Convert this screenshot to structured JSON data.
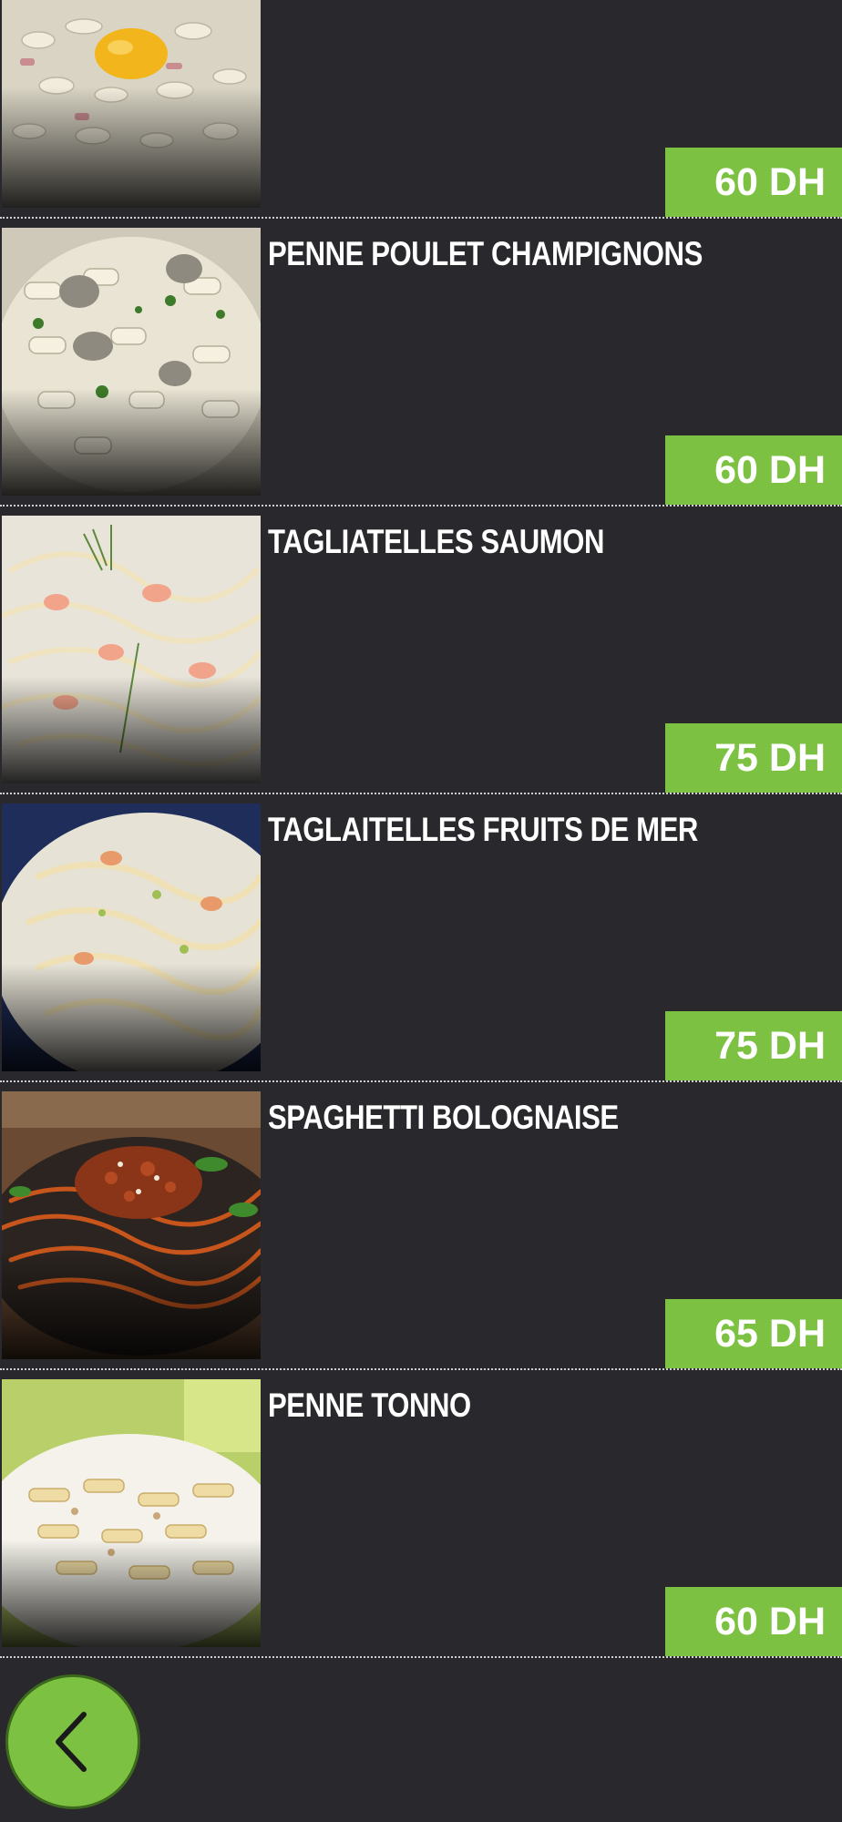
{
  "items": [
    {
      "name": "",
      "price": "60 DH",
      "image_icon": "pasta-carbonara-photo"
    },
    {
      "name": "PENNE POULET CHAMPIGNONS",
      "price": "60 DH",
      "image_icon": "penne-chicken-mushroom-photo"
    },
    {
      "name": "TAGLIATELLES SAUMON",
      "price": "75 DH",
      "image_icon": "tagliatelle-salmon-photo"
    },
    {
      "name": "TAGLAITELLES FRUITS DE MER",
      "price": "75 DH",
      "image_icon": "tagliatelle-seafood-photo"
    },
    {
      "name": "SPAGHETTI BOLOGNAISE",
      "price": "65 DH",
      "image_icon": "spaghetti-bolognese-photo"
    },
    {
      "name": "PENNE TONNO",
      "price": "60 DH",
      "image_icon": "penne-tuna-photo"
    }
  ],
  "navigation": {
    "back_icon": "chevron-left-icon"
  },
  "colors": {
    "background": "#28282d",
    "accent": "#7dc143",
    "text": "#ffffff",
    "divider": "#cfd0d4"
  }
}
